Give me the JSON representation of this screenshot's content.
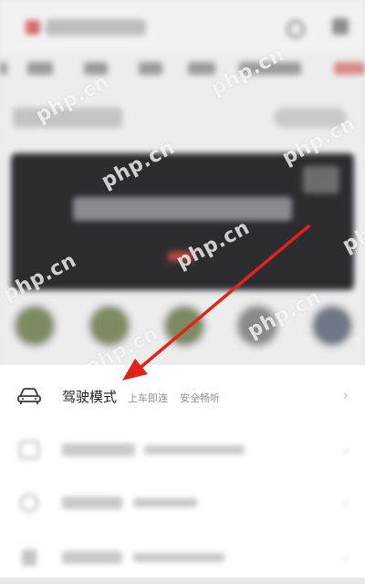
{
  "watermark": "php.cn",
  "sheet": {
    "driving_mode": {
      "title": "驾驶模式",
      "subtitle_1": "上车即连",
      "subtitle_2": "安全畅听",
      "icon": "car-icon"
    }
  },
  "colors": {
    "arrow": "#e0241b",
    "sheet_bg": "#ffffff"
  }
}
